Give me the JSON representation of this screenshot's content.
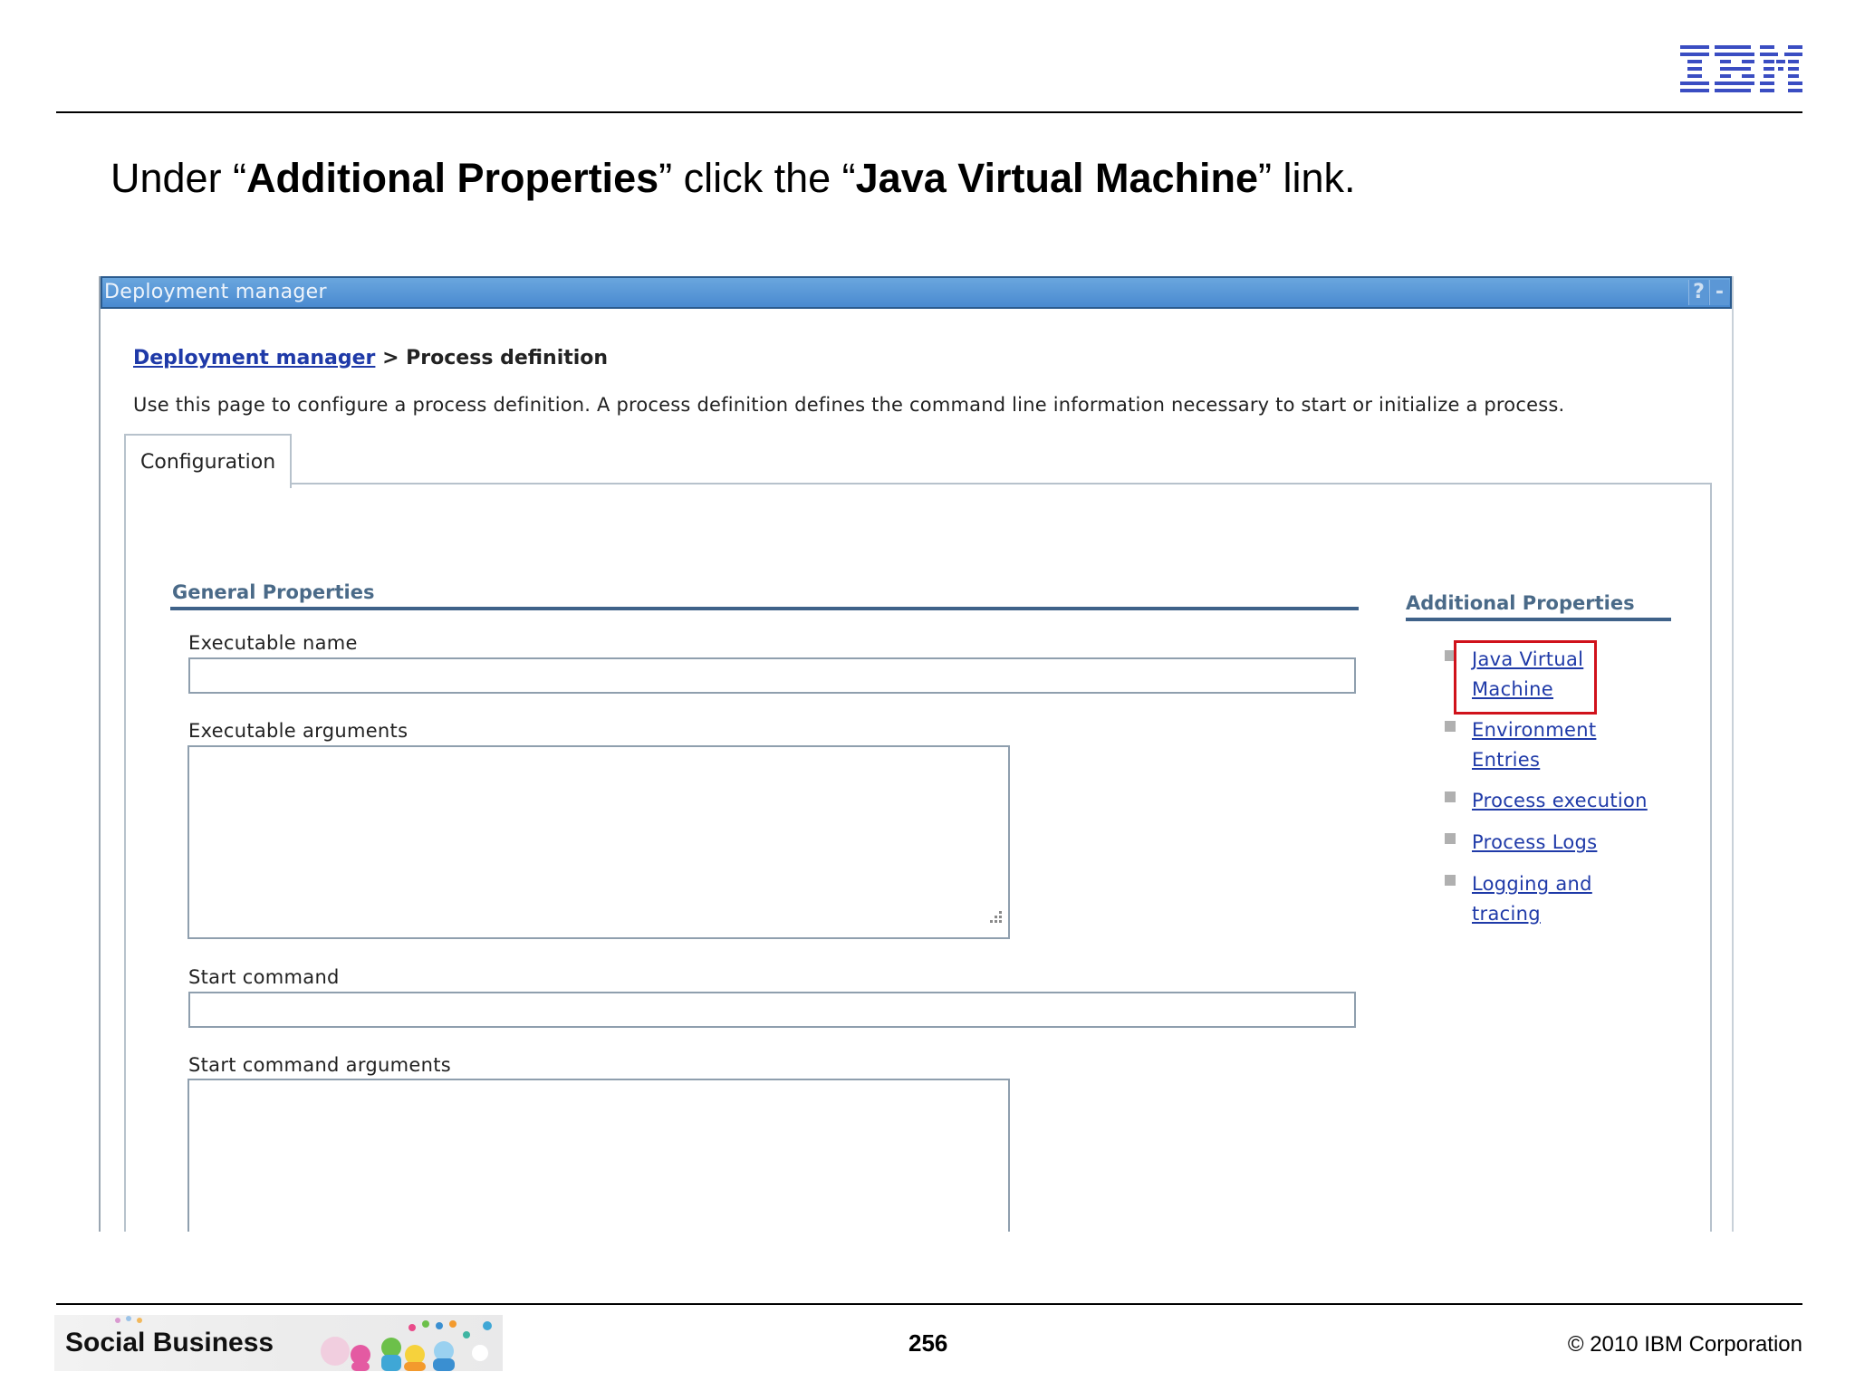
{
  "slide": {
    "headline": {
      "part1": "Under “",
      "bold1": "Additional Properties",
      "part2": "” click the “",
      "bold2": "Java Virtual Machine",
      "part3": "” link."
    },
    "footer": {
      "brand": "Social Business",
      "page_number": "256",
      "copyright": "© 2010 IBM Corporation"
    }
  },
  "console": {
    "titlebar": {
      "title": "Deployment manager",
      "help_label": "?",
      "minimize_label": "-"
    },
    "breadcrumb": {
      "link": "Deployment manager",
      "separator": " > ",
      "current": "Process definition"
    },
    "description": "Use this page to configure a process definition. A process definition defines the command line information necessary to start or initialize a process.",
    "tabs": [
      {
        "label": "Configuration",
        "selected": true
      }
    ],
    "general_properties": {
      "title": "General Properties",
      "fields": {
        "executable_name": {
          "label": "Executable name",
          "value": ""
        },
        "executable_arguments": {
          "label": "Executable arguments",
          "value": ""
        },
        "start_command": {
          "label": "Start command",
          "value": ""
        },
        "start_command_arguments": {
          "label": "Start command arguments",
          "value": ""
        }
      }
    },
    "additional_properties": {
      "title": "Additional Properties",
      "links": [
        {
          "label": "Java Virtual Machine",
          "highlighted": true
        },
        {
          "label": "Environment Entries"
        },
        {
          "label": "Process execution"
        },
        {
          "label": "Process Logs"
        },
        {
          "label": "Logging and tracing"
        }
      ]
    }
  },
  "colors": {
    "titlebar_blue": "#4a8ad0",
    "link_blue": "#1f3aa8",
    "section_rule": "#3f6289",
    "highlight_red": "#d0121b",
    "ibm_blue": "#3a4dc2"
  },
  "icons": [
    "ibm-logo",
    "help-icon",
    "minimize-icon",
    "bullet-icon",
    "resize-grip-icon"
  ]
}
